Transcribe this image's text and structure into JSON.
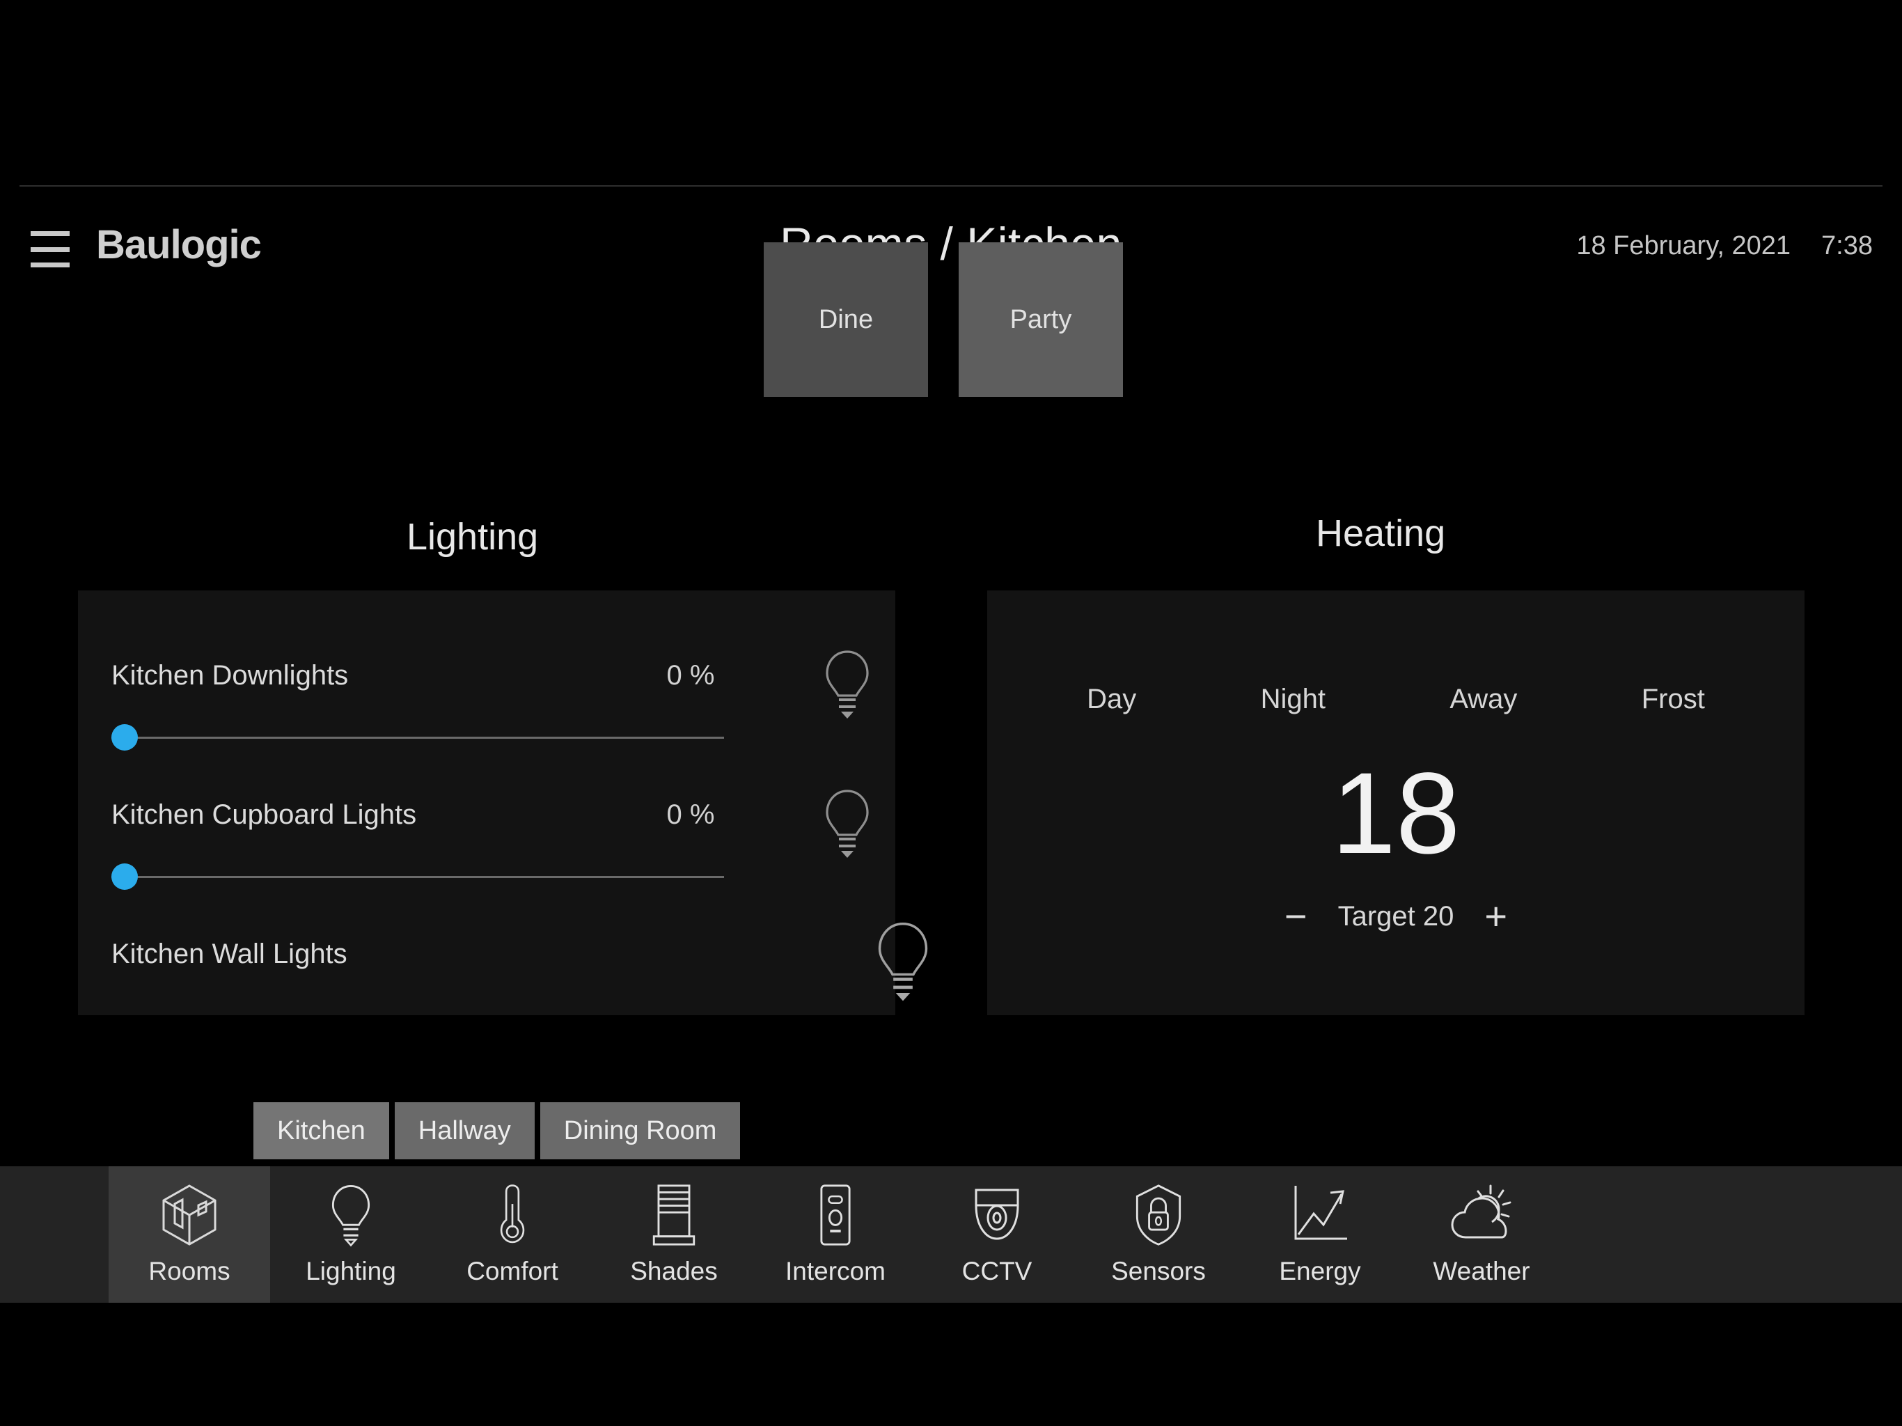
{
  "header": {
    "menu_icon": "hamburger-menu-icon",
    "brand": "Baulogic",
    "title": "Rooms / Kitchen",
    "date": "18 February, 2021",
    "time": "7:38"
  },
  "scenes": [
    {
      "label": "Dine"
    },
    {
      "label": "Party"
    }
  ],
  "lighting": {
    "heading": "Lighting",
    "rows": [
      {
        "name": "Kitchen Downlights",
        "percent": "0 %",
        "value": 0,
        "has_slider": true,
        "icon": "light-bulb-icon"
      },
      {
        "name": "Kitchen Cupboard Lights",
        "percent": "0 %",
        "value": 0,
        "has_slider": true,
        "icon": "light-bulb-icon"
      },
      {
        "name": "Kitchen Wall Lights",
        "percent": "",
        "value": 0,
        "has_slider": false,
        "icon": "light-bulb-icon"
      }
    ]
  },
  "heating": {
    "heading": "Heating",
    "modes": [
      {
        "label": "Day"
      },
      {
        "label": "Night"
      },
      {
        "label": "Away"
      },
      {
        "label": "Frost"
      }
    ],
    "current_temperature": "18",
    "target_label": "Target 20",
    "decrease_label": "−",
    "increase_label": "+"
  },
  "room_tabs": [
    {
      "label": "Kitchen",
      "active": true
    },
    {
      "label": "Hallway",
      "active": false
    },
    {
      "label": "Dining Room",
      "active": false
    }
  ],
  "bottom_nav": [
    {
      "label": "Rooms",
      "icon": "rooms-cube-icon",
      "active": true
    },
    {
      "label": "Lighting",
      "icon": "light-bulb-icon",
      "active": false
    },
    {
      "label": "Comfort",
      "icon": "thermometer-icon",
      "active": false
    },
    {
      "label": "Shades",
      "icon": "window-blind-icon",
      "active": false
    },
    {
      "label": "Intercom",
      "icon": "intercom-panel-icon",
      "active": false
    },
    {
      "label": "CCTV",
      "icon": "dome-camera-icon",
      "active": false
    },
    {
      "label": "Sensors",
      "icon": "shield-lock-icon",
      "active": false
    },
    {
      "label": "Energy",
      "icon": "line-chart-arrow-icon",
      "active": false
    },
    {
      "label": "Weather",
      "icon": "sun-cloud-icon",
      "active": false
    }
  ],
  "colors": {
    "background": "#000000",
    "panel": "#131313",
    "slider_handle": "#2bacec",
    "scene_button": "#4d4d4d",
    "nav_bar": "#242424",
    "nav_active": "#3a3a3a",
    "room_tab": "#6a6a6a"
  }
}
